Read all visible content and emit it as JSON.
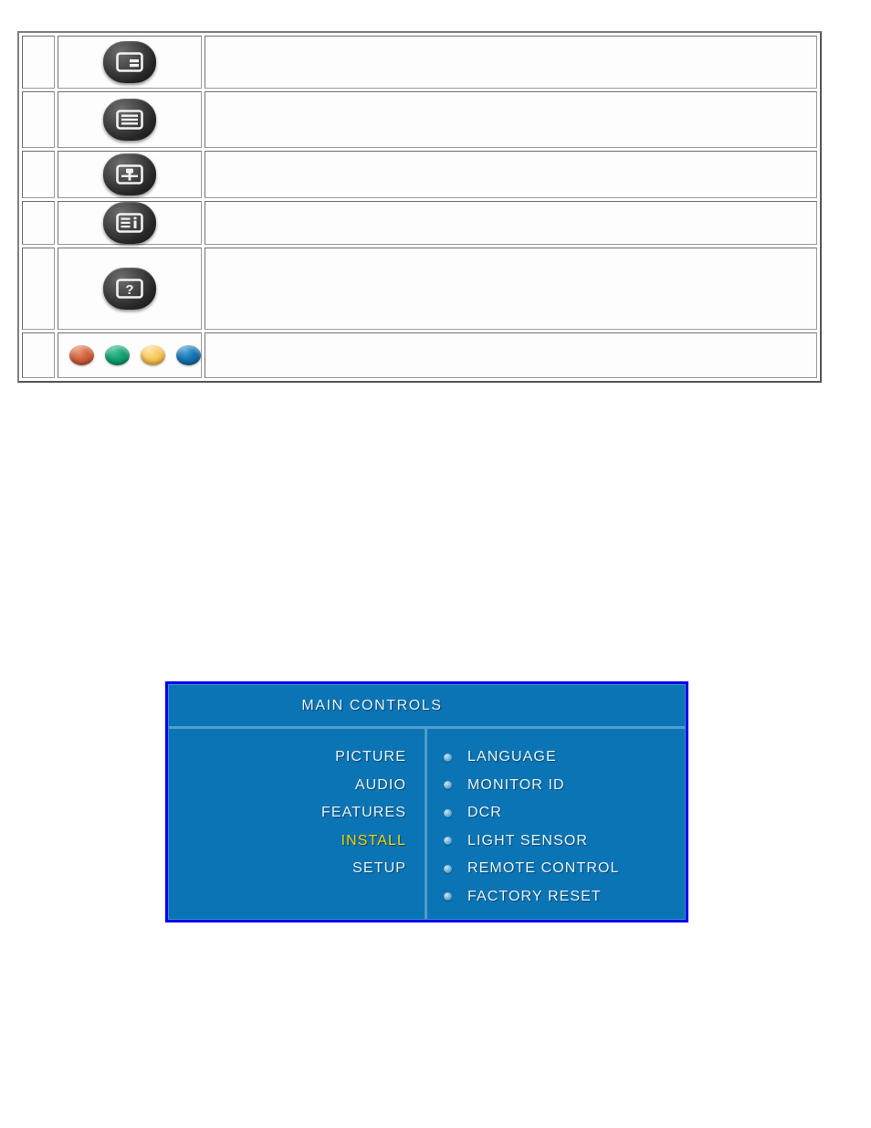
{
  "legend": {
    "rows": [
      {
        "index": "",
        "icon": "picture-in-picture-icon",
        "description": ""
      },
      {
        "index": "",
        "icon": "menu-lines-icon",
        "description": ""
      },
      {
        "index": "",
        "icon": "auto-adjust-icon",
        "description": ""
      },
      {
        "index": "",
        "icon": "information-icon",
        "description": ""
      },
      {
        "index": "",
        "icon": "help-question-icon",
        "description": ""
      },
      {
        "index": "",
        "icon": "color-dots-icon",
        "description": ""
      }
    ],
    "color_dots": [
      {
        "name": "red-dot",
        "color": "#c5512a"
      },
      {
        "name": "green-dot",
        "color": "#0e9b6c"
      },
      {
        "name": "yellow-dot",
        "color": "#f6c košt"
      },
      {
        "name": "blue-dot",
        "color": "#106aa8"
      }
    ]
  },
  "osd": {
    "title": "MAIN  CONTROLS",
    "border_color": "#0000ee",
    "background_color": "#0b74b4",
    "text_color": "#e8f4fb",
    "highlight_color": "#f2d400",
    "main_menu": [
      {
        "label": "PICTURE",
        "selected": false
      },
      {
        "label": "AUDIO",
        "selected": false
      },
      {
        "label": "FEATURES",
        "selected": false
      },
      {
        "label": "INSTALL",
        "selected": true
      },
      {
        "label": "SETUP",
        "selected": false
      }
    ],
    "sub_menu": [
      {
        "label": "LANGUAGE"
      },
      {
        "label": "MONITOR ID"
      },
      {
        "label": "DCR"
      },
      {
        "label": "LIGHT SENSOR"
      },
      {
        "label": "REMOTE CONTROL"
      },
      {
        "label": "FACTORY RESET"
      }
    ]
  }
}
